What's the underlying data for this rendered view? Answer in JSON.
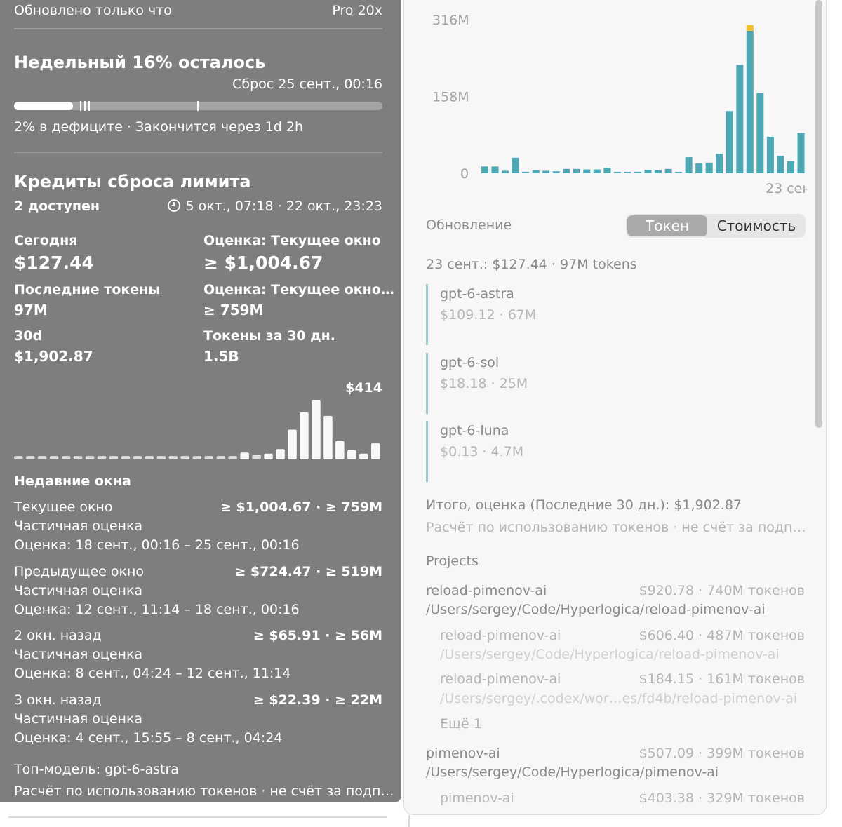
{
  "header": {
    "updated": "Обновлено только что",
    "plan": "Pro 20x"
  },
  "weekly": {
    "title": "Недельный 16% осталось",
    "reset": "Сброс 25 сент., 00:16",
    "progress_fraction": 0.16,
    "status": "2% в дефиците · Закончится через 1d 2h"
  },
  "credits": {
    "title": "Кредиты сброса лимита",
    "available": "2 доступен",
    "range": "5 окт., 07:18 · 22 окт., 23:23",
    "clock_icon": "clock-icon"
  },
  "stats": [
    {
      "label": "Сегодня",
      "value": "$127.44",
      "big": true
    },
    {
      "label": "Оценка: Текущее окно",
      "value": "≥ $1,004.67",
      "big": true
    },
    {
      "label": "Последние токены",
      "value": "97M",
      "big": false
    },
    {
      "label": "Оценка: Текущее окно…",
      "value": "≥ 759M",
      "big": false
    },
    {
      "label": "30d",
      "value": "$1,902.87",
      "big": false
    },
    {
      "label": "Токены за 30 дн.",
      "value": "1.5B",
      "big": false
    }
  ],
  "mini_chart": {
    "max_label": "$414",
    "values": [
      3,
      3,
      3,
      3,
      3,
      3,
      3,
      3,
      3,
      3,
      3,
      3,
      3,
      3,
      3,
      3,
      3,
      3,
      3,
      6,
      4,
      5,
      9,
      26,
      41,
      52,
      38,
      16,
      8,
      5,
      14
    ],
    "color": "#ffffff"
  },
  "recent": {
    "title": "Недавние окна",
    "windows": [
      {
        "name": "Текущее окно",
        "amount": "≥ $1,004.67 · ≥ 759M",
        "note": "Частичная оценка",
        "range": "Оценка: 18 сент., 00:16 – 25 сент., 00:16"
      },
      {
        "name": "Предыдущее окно",
        "amount": "≥ $724.47 · ≥ 519M",
        "note": "Частичная оценка",
        "range": "Оценка: 12 сент., 11:14 – 18 сент., 00:16"
      },
      {
        "name": "2 окн. назад",
        "amount": "≥ $65.91 · ≥ 56M",
        "note": "Частичная оценка",
        "range": "Оценка: 8 сент., 04:24 – 12 сент., 11:14"
      },
      {
        "name": "3 окн. назад",
        "amount": "≥ $22.39 · ≥ 22M",
        "note": "Частичная оценка",
        "range": "Оценка: 4 сент., 15:55 – 8 сент., 04:24"
      }
    ]
  },
  "footer": {
    "top_model": "Топ-модель: gpt-6-astra",
    "disclaimer": "Расчёт по использованию токенов · не счёт за подп…"
  },
  "chart_data": {
    "type": "bar",
    "y_ticks": [
      "316M",
      "158M",
      "0"
    ],
    "ylim": [
      0,
      316
    ],
    "x_label_visible": "23 сен",
    "values": [
      14,
      14,
      5,
      32,
      3,
      6,
      5,
      4,
      9,
      9,
      8,
      8,
      11,
      2,
      2,
      3,
      7,
      6,
      9,
      2,
      33,
      20,
      22,
      40,
      128,
      223,
      293,
      165,
      75,
      36,
      25,
      83
    ],
    "highlight": {
      "index": 26,
      "extra": 12,
      "color": "#f2c12e"
    },
    "color": "#4ea7b5",
    "grid": false
  },
  "usage": {
    "label": "Обновление",
    "toggle": {
      "active": "Токен",
      "inactive": "Стоимость"
    },
    "day_summary": "23 сент.: $127.44 · 97M tokens",
    "models": [
      {
        "name": "gpt-6-astra",
        "detail": "$109.12 · 67M"
      },
      {
        "name": "gpt-6-sol",
        "detail": "$18.18 · 25M"
      },
      {
        "name": "gpt-6-luna",
        "detail": "$0.13 · 4.7M"
      }
    ],
    "total": "Итого, оценка (Последние 30 дн.): $1,902.87",
    "disclaimer": "Расчёт по использованию токенов · не счёт за подп…"
  },
  "projects": {
    "title": "Projects",
    "items": [
      {
        "name": "reload-pimenov-ai",
        "amount": "$920.78 · 740M токенов",
        "path": "/Users/sergey/Code/Hyperlogica/reload-pimenov-ai"
      },
      {
        "name": "reload-pimenov-ai",
        "amount": "$606.40 · 487M токенов",
        "path": "/Users/sergey/Code/Hyperlogica/reload-pimenov-ai"
      },
      {
        "name": "reload-pimenov-ai",
        "amount": "$184.15 · 161M токенов",
        "path": "/Users/sergey/.codex/wor…es/fd4b/reload-pimenov-ai"
      },
      {
        "name": "pimenov-ai",
        "amount": "$507.09 · 399M токенов",
        "path": "/Users/sergey/Code/Hyperlogica/pimenov-ai"
      },
      {
        "name": "pimenov-ai",
        "amount": "$403.38 · 329M токенов"
      }
    ],
    "more": "Ещё 1"
  }
}
